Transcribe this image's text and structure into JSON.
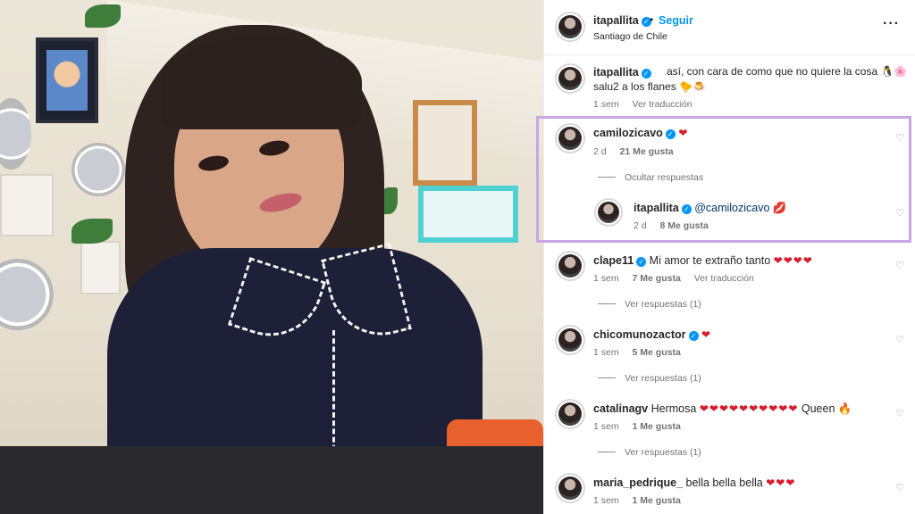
{
  "post": {
    "author": "itapallita",
    "follow_dot": "•",
    "follow_label": "Seguir",
    "location": "Santiago de Chile",
    "more_icon": "more-horizontal-icon",
    "caption_user": "itapallita",
    "caption_line1": "así, con cara de como que no quiere la cosa 🐧🌸",
    "caption_line2": "salu2 a los flanes 🐤🍮",
    "caption_time": "1 sem",
    "caption_translate": "Ver traducción"
  },
  "comments": [
    {
      "user": "camilozicavo",
      "verified": true,
      "text": "❤",
      "time": "2 d",
      "likes": "21 Me gusta",
      "replies_label": "Ocultar respuestas",
      "reply": {
        "user": "itapallita",
        "text": "@camilozicavo 💋",
        "time": "2 d",
        "likes": "8 Me gusta"
      }
    },
    {
      "user": "clape11",
      "verified": true,
      "text": "Mi amor te extraño tanto",
      "hearts": "❤❤❤❤",
      "time": "1 sem",
      "likes": "7 Me gusta",
      "translate": "Ver traducción",
      "replies_label": "Ver respuestas (1)"
    },
    {
      "user": "chicomunozactor",
      "verified": true,
      "text": "",
      "hearts": "❤",
      "time": "1 sem",
      "likes": "5 Me gusta",
      "replies_label": "Ver respuestas (1)"
    },
    {
      "user": "catalinagv",
      "verified": false,
      "text": "Hermosa",
      "hearts": "❤❤❤❤❤❤❤❤❤❤",
      "suffix": "Queen 🔥",
      "time": "1 sem",
      "likes": "1 Me gusta",
      "replies_label": "Ver respuestas (1)"
    },
    {
      "user": "maria_pedrique_",
      "verified": false,
      "text": "bella bella bella",
      "hearts": "❤❤❤",
      "time": "1 sem",
      "likes": "1 Me gusta"
    }
  ],
  "icons": {
    "verified": "verified-badge-icon",
    "like": "heart-outline-icon"
  },
  "colors": {
    "accent_blue": "#0095f6",
    "highlight_border": "#c9a6e6",
    "heart_red": "#d81b2a"
  }
}
